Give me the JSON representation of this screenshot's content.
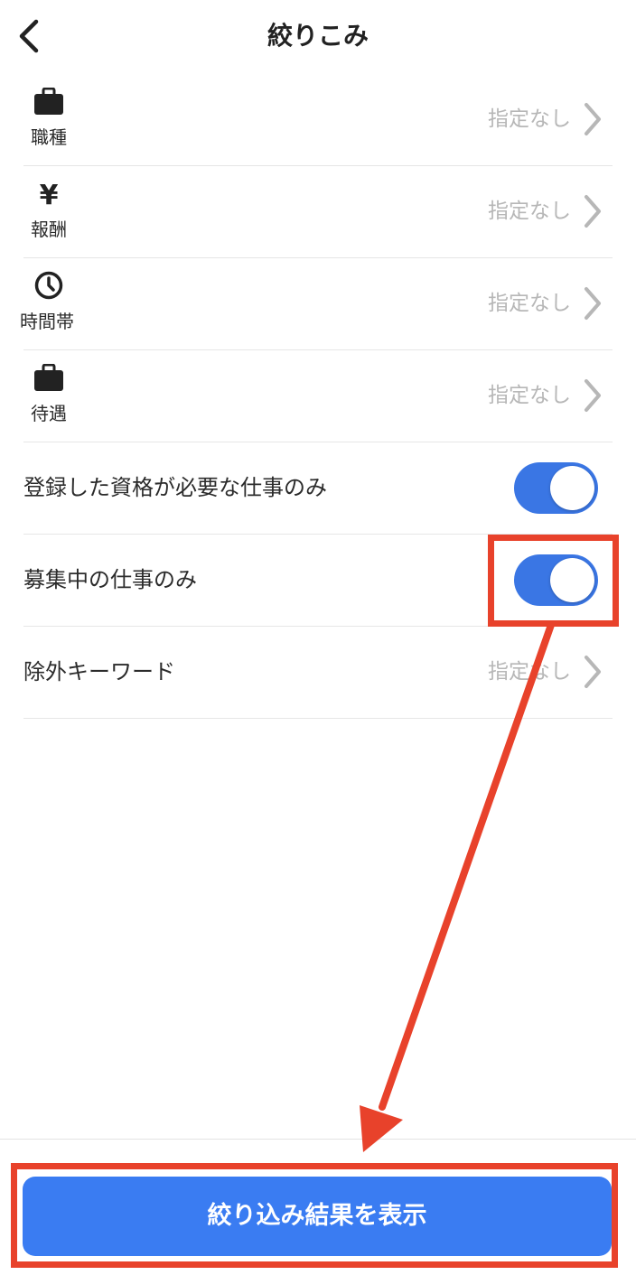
{
  "header": {
    "title": "絞りこみ"
  },
  "filters": [
    {
      "label": "職種",
      "value": "指定なし",
      "icon": "briefcase-icon"
    },
    {
      "label": "報酬",
      "value": "指定なし",
      "icon": "yen-icon"
    },
    {
      "label": "時間帯",
      "value": "指定なし",
      "icon": "clock-icon"
    },
    {
      "label": "待遇",
      "value": "指定なし",
      "icon": "briefcase-icon"
    }
  ],
  "toggles": [
    {
      "label": "登録した資格が必要な仕事のみ",
      "on": true
    },
    {
      "label": "募集中の仕事のみ",
      "on": true
    }
  ],
  "exclude_keyword": {
    "label": "除外キーワード",
    "value": "指定なし"
  },
  "footer": {
    "button_label": "絞り込み結果を表示"
  },
  "colors": {
    "accent": "#3a7cf2",
    "toggle_on": "#3a76e4",
    "annotation": "#e8422b",
    "placeholder": "#b7b7b7"
  }
}
